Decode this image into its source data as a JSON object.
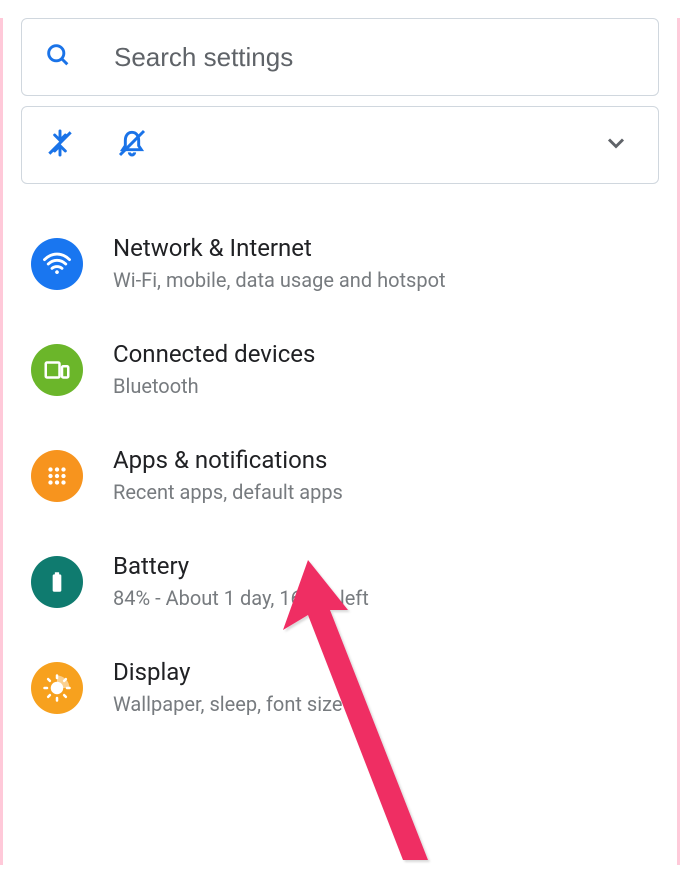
{
  "search": {
    "placeholder": "Search settings"
  },
  "settings": {
    "network": {
      "title": "Network & Internet",
      "subtitle": "Wi-Fi, mobile, data usage and hotspot"
    },
    "connected": {
      "title": "Connected devices",
      "subtitle": "Bluetooth"
    },
    "apps": {
      "title": "Apps & notifications",
      "subtitle": "Recent apps, default apps"
    },
    "battery": {
      "title": "Battery",
      "subtitle": "84% - About 1 day, 16 hrs left"
    },
    "display": {
      "title": "Display",
      "subtitle": "Wallpaper, sleep, font size"
    }
  }
}
